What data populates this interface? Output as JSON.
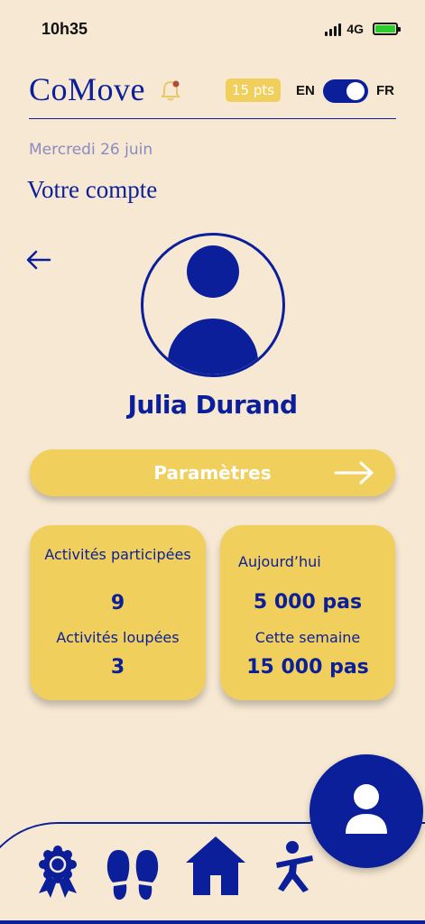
{
  "status_bar": {
    "time": "10h35",
    "network": "4G"
  },
  "header": {
    "logo": "CoMove",
    "points": "15 pts",
    "lang_left": "EN",
    "lang_right": "FR"
  },
  "date": "Mercredi 26 juin",
  "page_title": "Votre compte",
  "profile": {
    "name": "Julia Durand"
  },
  "settings_button": {
    "label": "Paramètres"
  },
  "stats": {
    "activities_attended_label": "Activités participées",
    "activities_attended_value": "9",
    "activities_missed_label": "Activités loupées",
    "activities_missed_value": "3",
    "today_label": "Aujourd’hui",
    "today_value": "5 000 pas",
    "week_label": "Cette semaine",
    "week_value": "15 000 pas"
  },
  "colors": {
    "background": "#f7e8d3",
    "primary": "#0b1f9a",
    "accent": "#f0cf5c"
  },
  "icons": {
    "nav": [
      "badge-icon",
      "footsteps-icon",
      "home-icon",
      "exercise-icon"
    ],
    "fab": "profile-icon"
  }
}
